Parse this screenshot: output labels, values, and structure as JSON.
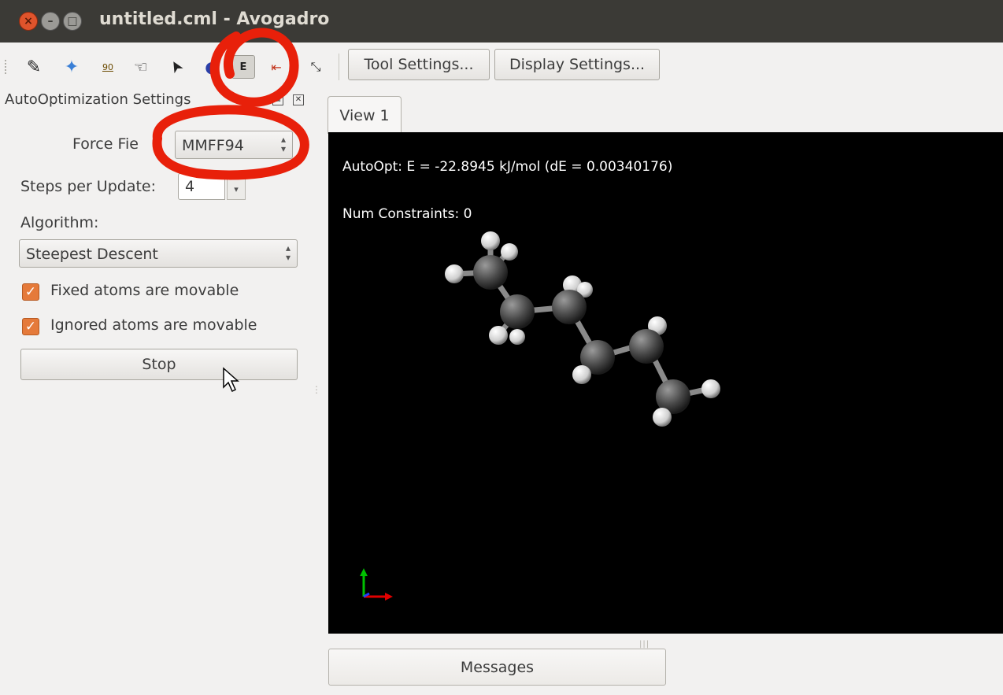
{
  "window": {
    "title": "untitled.cml - Avogadro",
    "buttons": {
      "close": "×",
      "minimize": "–",
      "maximize": "□"
    }
  },
  "toolbar": {
    "tools": [
      {
        "name": "draw-tool-icon",
        "glyph": "✎"
      },
      {
        "name": "navigate-tool-icon",
        "glyph": "✦"
      },
      {
        "name": "bond-centric-manipulate-icon",
        "glyph": "90"
      },
      {
        "name": "manipulate-tool-icon",
        "glyph": "☜"
      },
      {
        "name": "select-rotate-tool-icon",
        "glyph": "➤"
      },
      {
        "name": "align-tool-icon",
        "glyph": "◐"
      },
      {
        "name": "auto-optimization-tool-icon",
        "glyph": "E"
      },
      {
        "name": "measure-tool-icon",
        "glyph": "⇤"
      },
      {
        "name": "symmetry-tool-icon",
        "glyph": "⤡"
      }
    ],
    "tool_settings_label": "Tool Settings...",
    "display_settings_label": "Display Settings..."
  },
  "dock": {
    "title": "AutoOptimization Settings",
    "force_field_label": "Force Fie",
    "force_field_value": "MMFF94",
    "steps_label": "Steps per Update:",
    "steps_value": "4",
    "algorithm_label": "Algorithm:",
    "algorithm_value": "Steepest Descent",
    "fixed_atoms_label": "Fixed atoms are movable",
    "fixed_atoms_checked": true,
    "ignored_atoms_label": "Ignored atoms are movable",
    "ignored_atoms_checked": true,
    "stop_label": "Stop"
  },
  "view": {
    "tab_label": "View 1",
    "energy_text": "AutoOpt: E = -22.8945 kJ/mol (dE = 0.00340176)",
    "constraints_text": "Num Constraints: 0"
  },
  "messages_label": "Messages",
  "colors": {
    "annotation_red": "#e8200a",
    "checkbox_orange": "#e57a3a",
    "titlebar": "#3b3a36"
  }
}
